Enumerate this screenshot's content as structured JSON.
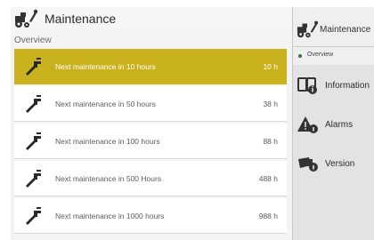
{
  "header": {
    "title": "Maintenance",
    "icon": "tractor-wrench-icon"
  },
  "breadcrumb": "Overview",
  "rows": [
    {
      "label": "Next maintenance in 10 hours",
      "value": "10 h",
      "selected": true
    },
    {
      "label": "Next maintenance in 50 hours",
      "value": "38 h"
    },
    {
      "label": "Next maintenance in 100 hours",
      "value": "88 h"
    },
    {
      "label": "Next maintenance in 500 Hours",
      "value": "488 h"
    },
    {
      "label": "Next maintenance in 1000 hours",
      "value": "988 h"
    }
  ],
  "right_panel": {
    "title": "Maintenance",
    "subtitle": "Overview",
    "nav": [
      {
        "label": "Information",
        "icon": "info-book-icon"
      },
      {
        "label": "Alarms",
        "icon": "warning-icon"
      },
      {
        "label": "Version",
        "icon": "version-info-icon"
      }
    ]
  },
  "colors": {
    "accent": "#c9b21d",
    "background": "#ececec",
    "dot": "#3c6f3a"
  }
}
